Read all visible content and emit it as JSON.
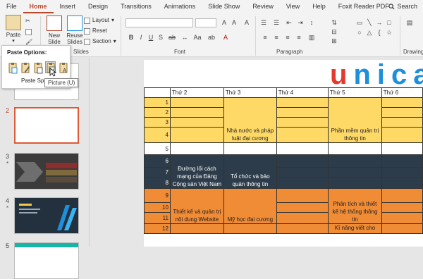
{
  "menu": {
    "tabs": [
      "File",
      "Home",
      "Insert",
      "Design",
      "Transitions",
      "Animations",
      "Slide Show",
      "Review",
      "View",
      "Help",
      "Foxit Reader PDF"
    ],
    "active": "Home",
    "search": "Search"
  },
  "ribbon": {
    "paste": "Paste",
    "new_slide": [
      "New",
      "Slide"
    ],
    "reuse_slides": [
      "Reuse",
      "Slides"
    ],
    "layout": "Layout",
    "reset": "Reset",
    "section": "Section",
    "groups": {
      "slides": "Slides",
      "font": "Font",
      "paragraph": "Paragraph",
      "drawing": "Drawing"
    }
  },
  "paste_panel": {
    "title": "Paste Options:",
    "more": "Paste Spe",
    "tooltip": "Picture (U)",
    "option_icons": [
      "use-destination-theme-icon",
      "keep-source-formatting-icon",
      "embed-icon",
      "picture-icon",
      "keep-text-only-icon"
    ]
  },
  "thumbnails": [
    {
      "number": "2",
      "star": ""
    },
    {
      "number": "3",
      "star": "*"
    },
    {
      "number": "4",
      "star": "*"
    },
    {
      "number": "5",
      "star": ""
    }
  ],
  "slide": {
    "logo": "unica",
    "headers": [
      "Thứ 2",
      "Thứ 3",
      "Thứ 4",
      "Thứ 5",
      "Thứ 6"
    ],
    "row_numbers": [
      "1",
      "2",
      "3",
      "4",
      "5",
      "6",
      "7",
      "8",
      "9",
      "10",
      "11",
      "12"
    ],
    "cells": {
      "mon_block2": "Đường lối cách mạng của Đảng Cộng sản Việt Nam",
      "mon_block3": "Thiết kế và quản trị nội dung Website",
      "tue_block1": "Nhà nước và pháp luật đại cương",
      "tue_block2": "Tổ chức và bảo quản thông tin",
      "tue_block3": "Mỹ học đại cương",
      "thu_block1": "Phần mềm quản trị thông tin",
      "thu_block3": "Phân tích và thiết kế hệ thống thông tin",
      "thu_block4": "Kĩ năng viết cho"
    }
  }
}
